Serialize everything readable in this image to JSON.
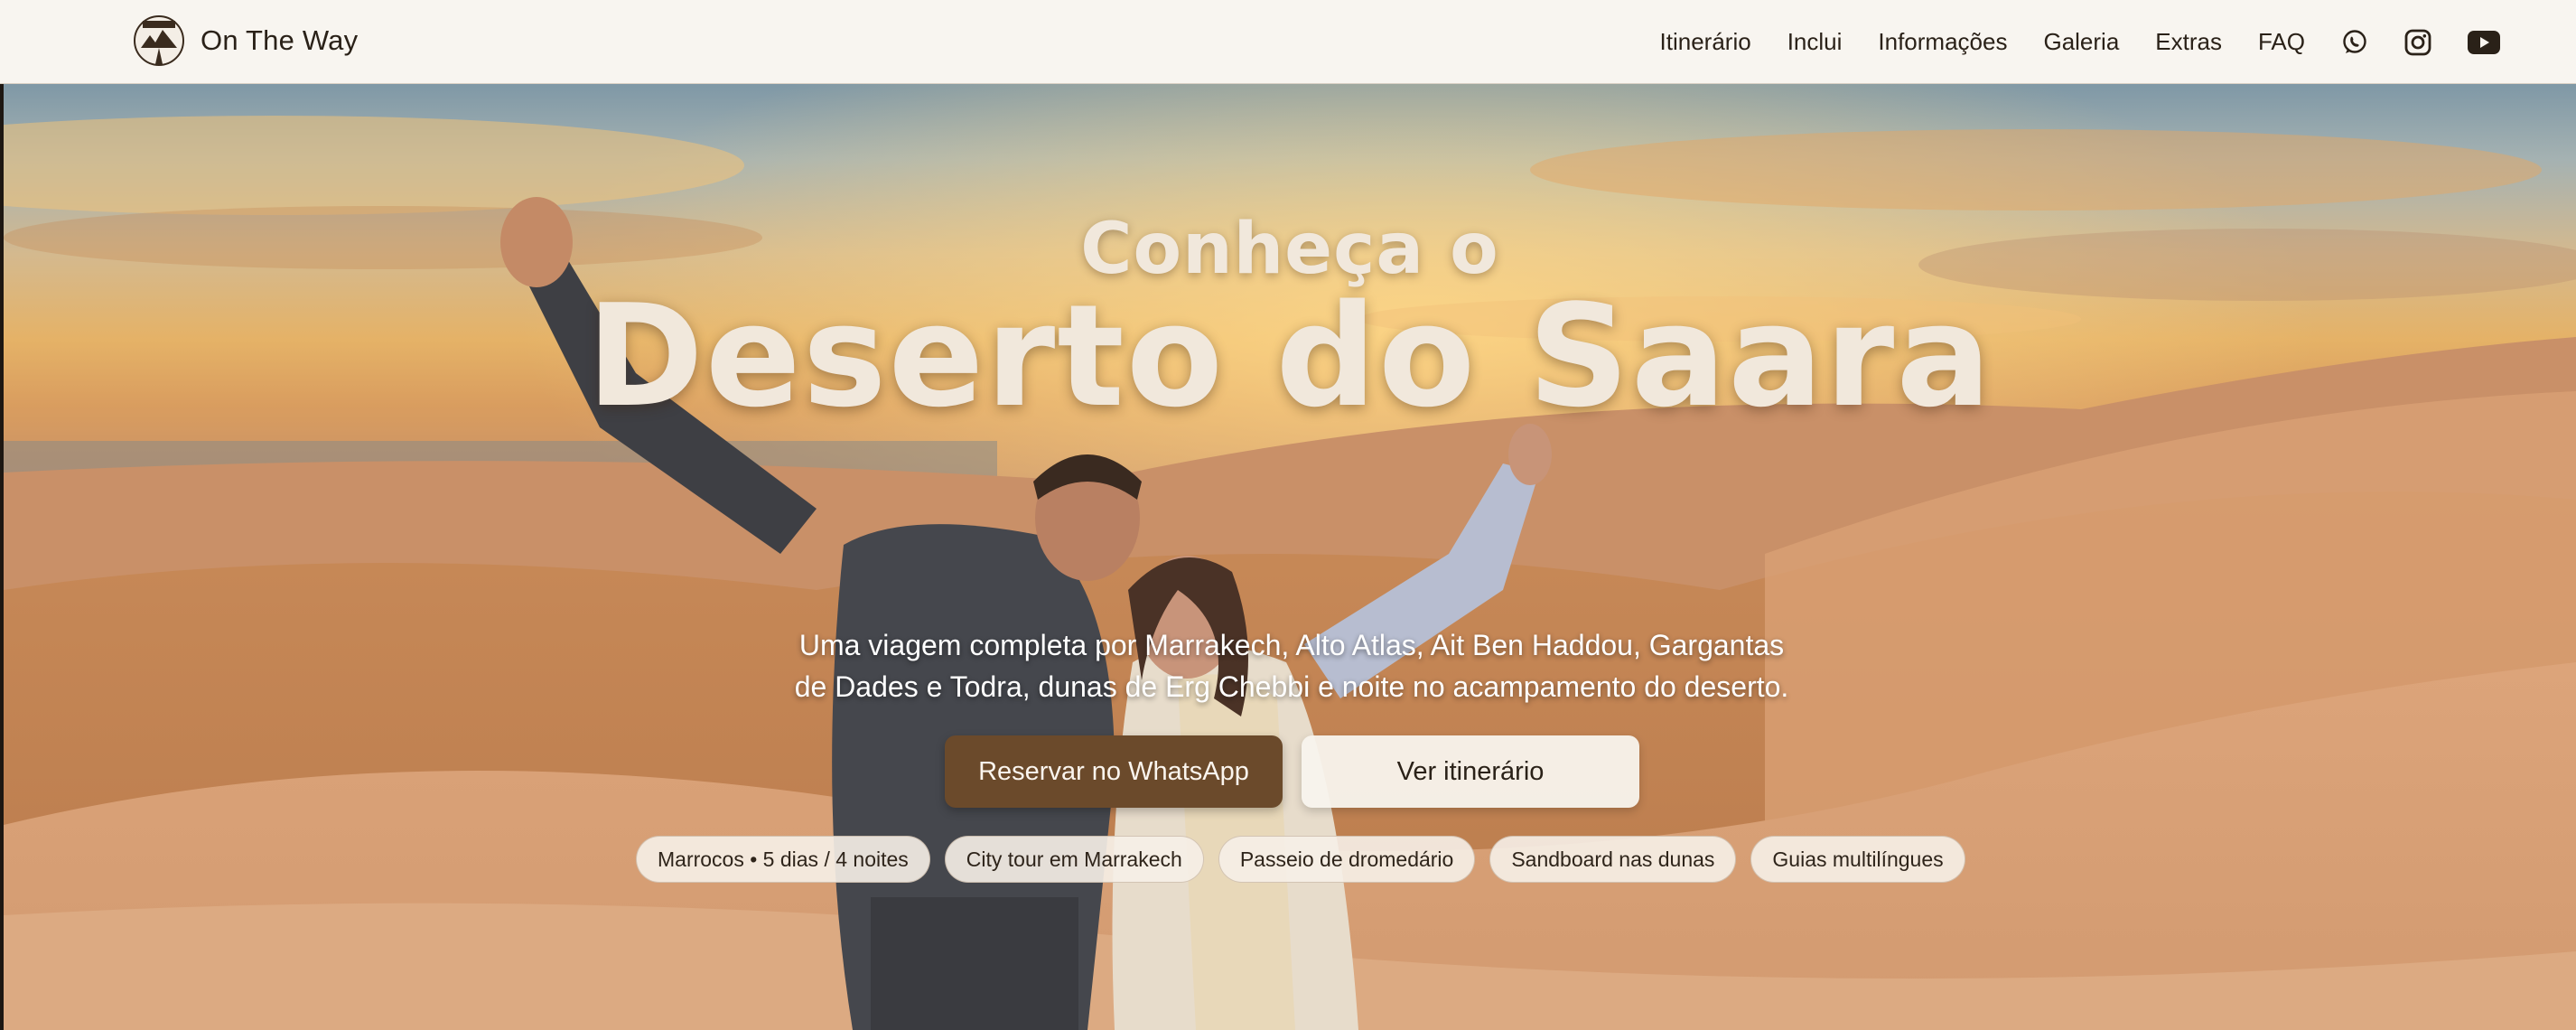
{
  "header": {
    "brand": "On The Way",
    "logo_text": "ON THE WAY",
    "nav": [
      "Itinerário",
      "Inclui",
      "Informações",
      "Galeria",
      "Extras",
      "FAQ"
    ],
    "icons": [
      "whatsapp-icon",
      "instagram-icon",
      "youtube-icon"
    ]
  },
  "hero": {
    "title_small": "Conheça o",
    "title_big": "Deserto do Saara",
    "subtitle_line1": "Uma viagem completa por Marrakech, Alto Atlas, Ait Ben Haddou, Gargantas",
    "subtitle_line2": "de Dades e Todra, dunas de Erg Chebbi e noite no acampamento do deserto.",
    "primary_button": "Reservar no WhatsApp",
    "secondary_button": "Ver itinerário",
    "chips": [
      "Marrocos • 5 dias / 4 noites",
      "City tour em Marrakech",
      "Passeio de dromedário",
      "Sandboard nas dunas",
      "Guias multilíngues"
    ]
  },
  "colors": {
    "header_bg": "#f8f5f0",
    "primary_button": "#6b4a2b",
    "title_text": "#f1e8dc",
    "chip_bg": "#f6f0e8"
  }
}
